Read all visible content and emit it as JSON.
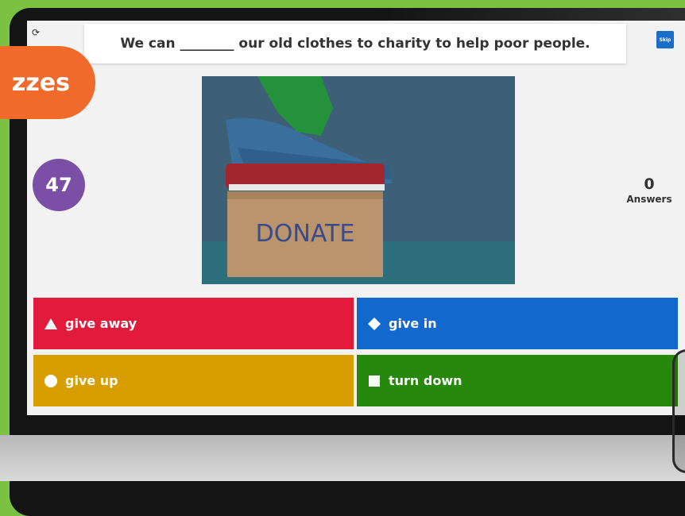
{
  "question": {
    "text": "We can ________ our old clothes to charity to help poor people."
  },
  "skip_label": "Skip",
  "timer_value": "47",
  "answers_count": {
    "value": "0",
    "label": "Answers"
  },
  "image": {
    "box_text": "DONATE"
  },
  "options": [
    {
      "label": "give away",
      "color": "#e21b3c",
      "shape": "triangle"
    },
    {
      "label": "give in",
      "color": "#1368ce",
      "shape": "diamond"
    },
    {
      "label": "give up",
      "color": "#d89e00",
      "shape": "circle"
    },
    {
      "label": "turn down",
      "color": "#26890c",
      "shape": "square"
    }
  ],
  "tag_label": "zzes"
}
